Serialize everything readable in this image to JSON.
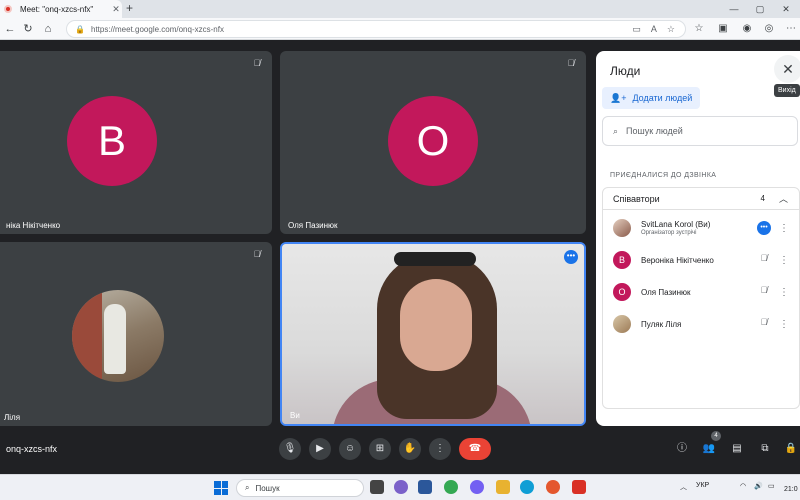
{
  "browser": {
    "tab_title": "Meet: \"onq-xzcs-nfx\"",
    "tab_close": "✕",
    "new_tab": "+",
    "url": "https://meet.google.com/onq-xzcs-nfx",
    "window_controls": [
      "—",
      "▢",
      "✕"
    ]
  },
  "tiles": [
    {
      "name": "ніка Нікітченко",
      "initial": "В",
      "muted": true
    },
    {
      "name": "Оля Пазинюк",
      "initial": "О",
      "muted": true
    },
    {
      "name": "Ліля",
      "muted": true
    },
    {
      "name": "Ви"
    }
  ],
  "panel": {
    "title": "Люди",
    "close_tooltip": "Вихід",
    "add_people": "Додати людей",
    "search_placeholder": "Пошук людей",
    "section_label": "ПРИЄДНАЛИСЯ ДО ДЗВІНКА",
    "group_label": "Співавтори",
    "group_count": "4",
    "participants": [
      {
        "name": "SvitLana Korol (Ви)",
        "role": "Організатор зустрічі",
        "avatar": "photo"
      },
      {
        "name": "Вероніка Нікітченко",
        "initial": "В"
      },
      {
        "name": "Оля Пазинюк",
        "initial": "О"
      },
      {
        "name": "Пуляк Ліля",
        "avatar": "photo"
      }
    ]
  },
  "controls": {
    "meeting_code": "onq-xzcs-nfx",
    "people_badge": "4"
  },
  "taskbar": {
    "search_label": "Пошук",
    "language": "УКР",
    "time": "21:0"
  },
  "colors": {
    "avatar": "#c2185b",
    "accent": "#1a73e8",
    "end_call": "#ea4335",
    "background": "#202124"
  }
}
